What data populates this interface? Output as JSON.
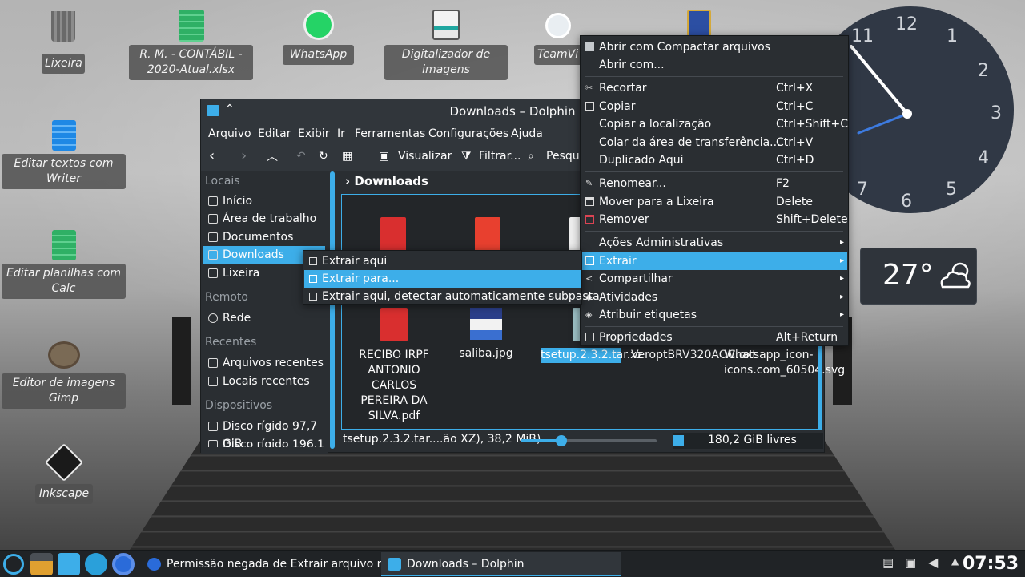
{
  "desktop": {
    "icons": [
      {
        "label": "Lixeira"
      },
      {
        "label": "R. M. - CONTÁBIL - 2020-Atual.xlsx"
      },
      {
        "label": "WhatsApp"
      },
      {
        "label": "Digitalizador de imagens"
      },
      {
        "label": "TeamVi"
      },
      {
        "label": "Editar textos com Writer"
      },
      {
        "label": "Editar planilhas com Calc"
      },
      {
        "label": "Editor de imagens Gimp"
      },
      {
        "label": "Inkscape"
      }
    ],
    "clock_numbers": [
      "12",
      "1",
      "2",
      "3",
      "4",
      "5",
      "6",
      "7",
      "11"
    ],
    "weather": {
      "temperature": "27°",
      "icon": "partly-cloudy-icon"
    }
  },
  "dolphin": {
    "title": "Downloads – Dolphin",
    "menu": [
      "Arquivo",
      "Editar",
      "Exibir",
      "Ir",
      "Ferramentas",
      "Configurações",
      "Ajuda"
    ],
    "toolbar": {
      "view_label": "Visualizar",
      "filter_label": "Filtrar...",
      "search_label": "Pesqui"
    },
    "places": {
      "headers": {
        "locais": "Locais",
        "remoto": "Remoto",
        "recentes": "Recentes",
        "dispositivos": "Dispositivos"
      },
      "locais": [
        "Início",
        "Área de trabalho",
        "Documentos",
        "Downloads",
        "Lixeira"
      ],
      "remoto": [
        "Rede"
      ],
      "recentes": [
        "Arquivos recentes",
        "Locais recentes"
      ],
      "dispositivos": [
        "Disco rígido 97,7 GiB",
        "Disco rígido 196,1"
      ]
    },
    "breadcrumb": "Downloads",
    "files": [
      {
        "name": "RECIBO IRPF ANTONIO CARLOS PEREIRA DA SILVA.pdf",
        "icon": "pdf-icon"
      },
      {
        "name": "saliba.jpg",
        "icon": "image-thumbnail"
      },
      {
        "name": "tsetup.2.3.2.tar.xz",
        "icon": "archive-icon"
      },
      {
        "name": "VeroptBRV320AOC.oxt",
        "icon": "extension-icon"
      },
      {
        "name": "Whatsapp_icon-icons.com_60504.svg",
        "icon": "svg-icon"
      }
    ],
    "status": {
      "selected": "tsetup.2.3.2.tar....ão XZ), 38,2 MiB)",
      "free": "180,2 GiB livres",
      "zoom_fraction": 0.3
    }
  },
  "context_menu": {
    "items": [
      {
        "label": "Abrir com Compactar arquivos",
        "shortcut": "",
        "icon": "archive-icon"
      },
      {
        "label": "Abrir com...",
        "shortcut": "",
        "icon": ""
      },
      {
        "label": "Recortar",
        "shortcut": "Ctrl+X",
        "icon": "cut-icon"
      },
      {
        "label": "Copiar",
        "shortcut": "Ctrl+C",
        "icon": "copy-icon"
      },
      {
        "label": "Copiar a localização",
        "shortcut": "Ctrl+Shift+C",
        "icon": ""
      },
      {
        "label": "Colar da área de transferência...",
        "shortcut": "Ctrl+V",
        "icon": ""
      },
      {
        "label": "Duplicado Aqui",
        "shortcut": "Ctrl+D",
        "icon": ""
      },
      {
        "label": "Renomear...",
        "shortcut": "F2",
        "icon": "rename-icon"
      },
      {
        "label": "Mover para a Lixeira",
        "shortcut": "Delete",
        "icon": "trash-icon"
      },
      {
        "label": "Remover",
        "shortcut": "Shift+Delete",
        "icon": "delete-icon"
      },
      {
        "label": "Ações Administrativas",
        "shortcut": "",
        "icon": ""
      },
      {
        "label": "Extrair",
        "shortcut": "",
        "icon": "extract-icon"
      },
      {
        "label": "Compartilhar",
        "shortcut": "",
        "icon": "share-icon"
      },
      {
        "label": "Atividades",
        "shortcut": "",
        "icon": "activities-icon"
      },
      {
        "label": "Atribuir etiquetas",
        "shortcut": "",
        "icon": "tag-icon"
      },
      {
        "label": "Propriedades",
        "shortcut": "Alt+Return",
        "icon": "properties-icon"
      }
    ],
    "submenu": [
      "Extrair aqui",
      "Extrair para...",
      "Extrair aqui, detectar automaticamente subpasta"
    ]
  },
  "taskbar": {
    "tasks": [
      {
        "label": "Permissão negada de Extrair arquivo na..."
      },
      {
        "label": "Downloads – Dolphin"
      }
    ],
    "time": "07:53"
  },
  "colors": {
    "accent": "#3daee9",
    "window_bg": "#2a2e32",
    "taskbar_bg": "#202326"
  }
}
